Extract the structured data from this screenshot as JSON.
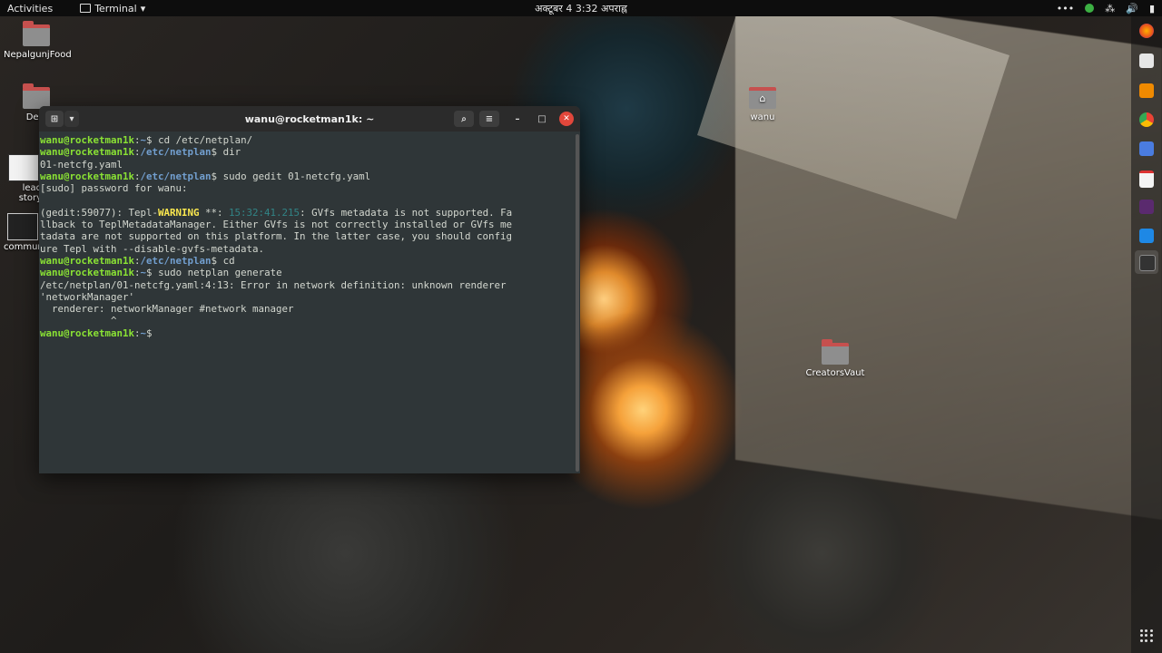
{
  "topbar": {
    "activities": "Activities",
    "app_menu": "Terminal",
    "app_menu_caret": "▾",
    "clock": "अक्टूबर 4  3:32 अपराह्न",
    "tray": {
      "more": "•••",
      "network": "⁂",
      "volume": "🔊",
      "battery": "▮"
    }
  },
  "desktop_icons": [
    {
      "label": "NepalgunjFood"
    },
    {
      "label": "Devi"
    },
    {
      "label": "lead"
    },
    {
      "label": "story"
    },
    {
      "label": "commun"
    },
    {
      "label": "wanu"
    },
    {
      "label": "CreatorsVaut"
    }
  ],
  "terminal": {
    "title": "wanu@rocketman1k: ~",
    "user_host": "wanu@rocketman1k",
    "colon": ":",
    "home": "~",
    "netplan": "/etc/netplan",
    "dollar": "$",
    "cmd1": " cd /etc/netplan/",
    "cmd2": " dir",
    "out_dir": "01-netcfg.yaml",
    "cmd3": " sudo gedit 01-netcfg.yaml",
    "sudo_prompt": "[sudo] password for wanu:",
    "gedit_prefix": "(gedit:59077): Tepl-",
    "warning": "WARNING",
    "stars": " **: ",
    "timestamp": "15:32:41.215",
    "gedit_msg1": ": GVfs metadata is not supported. Fa",
    "gedit_msg2": "llback to TeplMetadataManager. Either GVfs is not correctly installed or GVfs me",
    "gedit_msg3": "tadata are not supported on this platform. In the latter case, you should config",
    "gedit_msg4": "ure Tepl with --disable-gvfs-metadata.",
    "cmd4": " cd",
    "cmd5": " sudo netplan generate",
    "err1": "/etc/netplan/01-netcfg.yaml:4:13: Error in network definition: unknown renderer",
    "err2": "'networkManager'",
    "err3": "  renderer: networkManager #network manager",
    "err4": "            ^"
  },
  "colors": {
    "prompt_user": "#8ae234",
    "prompt_path": "#729fcf",
    "warning": "#fce94f",
    "terminal_bg": "#2f3638",
    "close_button": "#e2473b"
  }
}
